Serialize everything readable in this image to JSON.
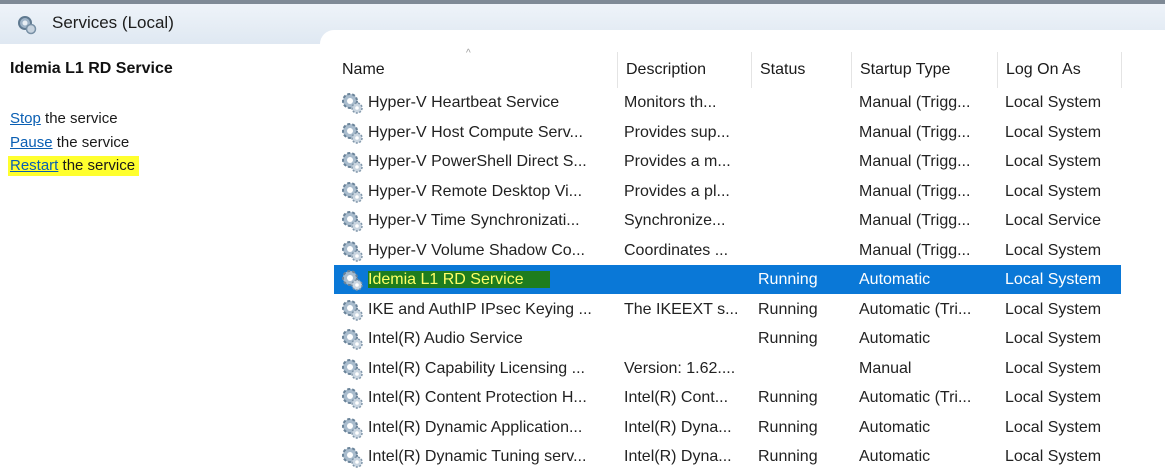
{
  "header": {
    "title": "Services (Local)",
    "icon": "gear-search-icon"
  },
  "left": {
    "service_title": "Idemia L1 RD Service",
    "actions": [
      {
        "link": "Stop",
        "rest": " the service"
      },
      {
        "link": "Pause",
        "rest": " the service"
      },
      {
        "link": "Restart",
        "rest": " the service"
      }
    ],
    "highlight_color": "#ffff2e"
  },
  "table": {
    "columns": [
      "Name",
      "Description",
      "Status",
      "Startup Type",
      "Log On As"
    ],
    "selected_color": "#0a78d7",
    "rows": [
      {
        "name": "Hyper-V Heartbeat Service",
        "desc": "Monitors th...",
        "status": "",
        "startup": "Manual (Trigg...",
        "logon": "Local System"
      },
      {
        "name": "Hyper-V Host Compute Serv...",
        "desc": "Provides sup...",
        "status": "",
        "startup": "Manual (Trigg...",
        "logon": "Local System"
      },
      {
        "name": "Hyper-V PowerShell Direct S...",
        "desc": "Provides a m...",
        "status": "",
        "startup": "Manual (Trigg...",
        "logon": "Local System"
      },
      {
        "name": "Hyper-V Remote Desktop Vi...",
        "desc": "Provides a pl...",
        "status": "",
        "startup": "Manual (Trigg...",
        "logon": "Local System"
      },
      {
        "name": "Hyper-V Time Synchronizati...",
        "desc": "Synchronize...",
        "status": "",
        "startup": "Manual (Trigg...",
        "logon": "Local Service"
      },
      {
        "name": "Hyper-V Volume Shadow Co...",
        "desc": "Coordinates ...",
        "status": "",
        "startup": "Manual (Trigg...",
        "logon": "Local System"
      },
      {
        "name": "Idemia L1 RD Service",
        "desc": "",
        "status": "Running",
        "startup": "Automatic",
        "logon": "Local System"
      },
      {
        "name": "IKE and AuthIP IPsec Keying ...",
        "desc": "The IKEEXT s...",
        "status": "Running",
        "startup": "Automatic (Tri...",
        "logon": "Local System"
      },
      {
        "name": "Intel(R) Audio Service",
        "desc": "",
        "status": "Running",
        "startup": "Automatic",
        "logon": "Local System"
      },
      {
        "name": "Intel(R) Capability Licensing ...",
        "desc": "Version: 1.62....",
        "status": "",
        "startup": "Manual",
        "logon": "Local System"
      },
      {
        "name": "Intel(R) Content Protection H...",
        "desc": "Intel(R) Cont...",
        "status": "Running",
        "startup": "Automatic (Tri...",
        "logon": "Local System"
      },
      {
        "name": "Intel(R) Dynamic Application...",
        "desc": "Intel(R) Dyna...",
        "status": "Running",
        "startup": "Automatic",
        "logon": "Local System"
      },
      {
        "name": "Intel(R) Dynamic Tuning serv...",
        "desc": "Intel(R) Dyna...",
        "status": "Running",
        "startup": "Automatic",
        "logon": "Local System"
      }
    ]
  }
}
